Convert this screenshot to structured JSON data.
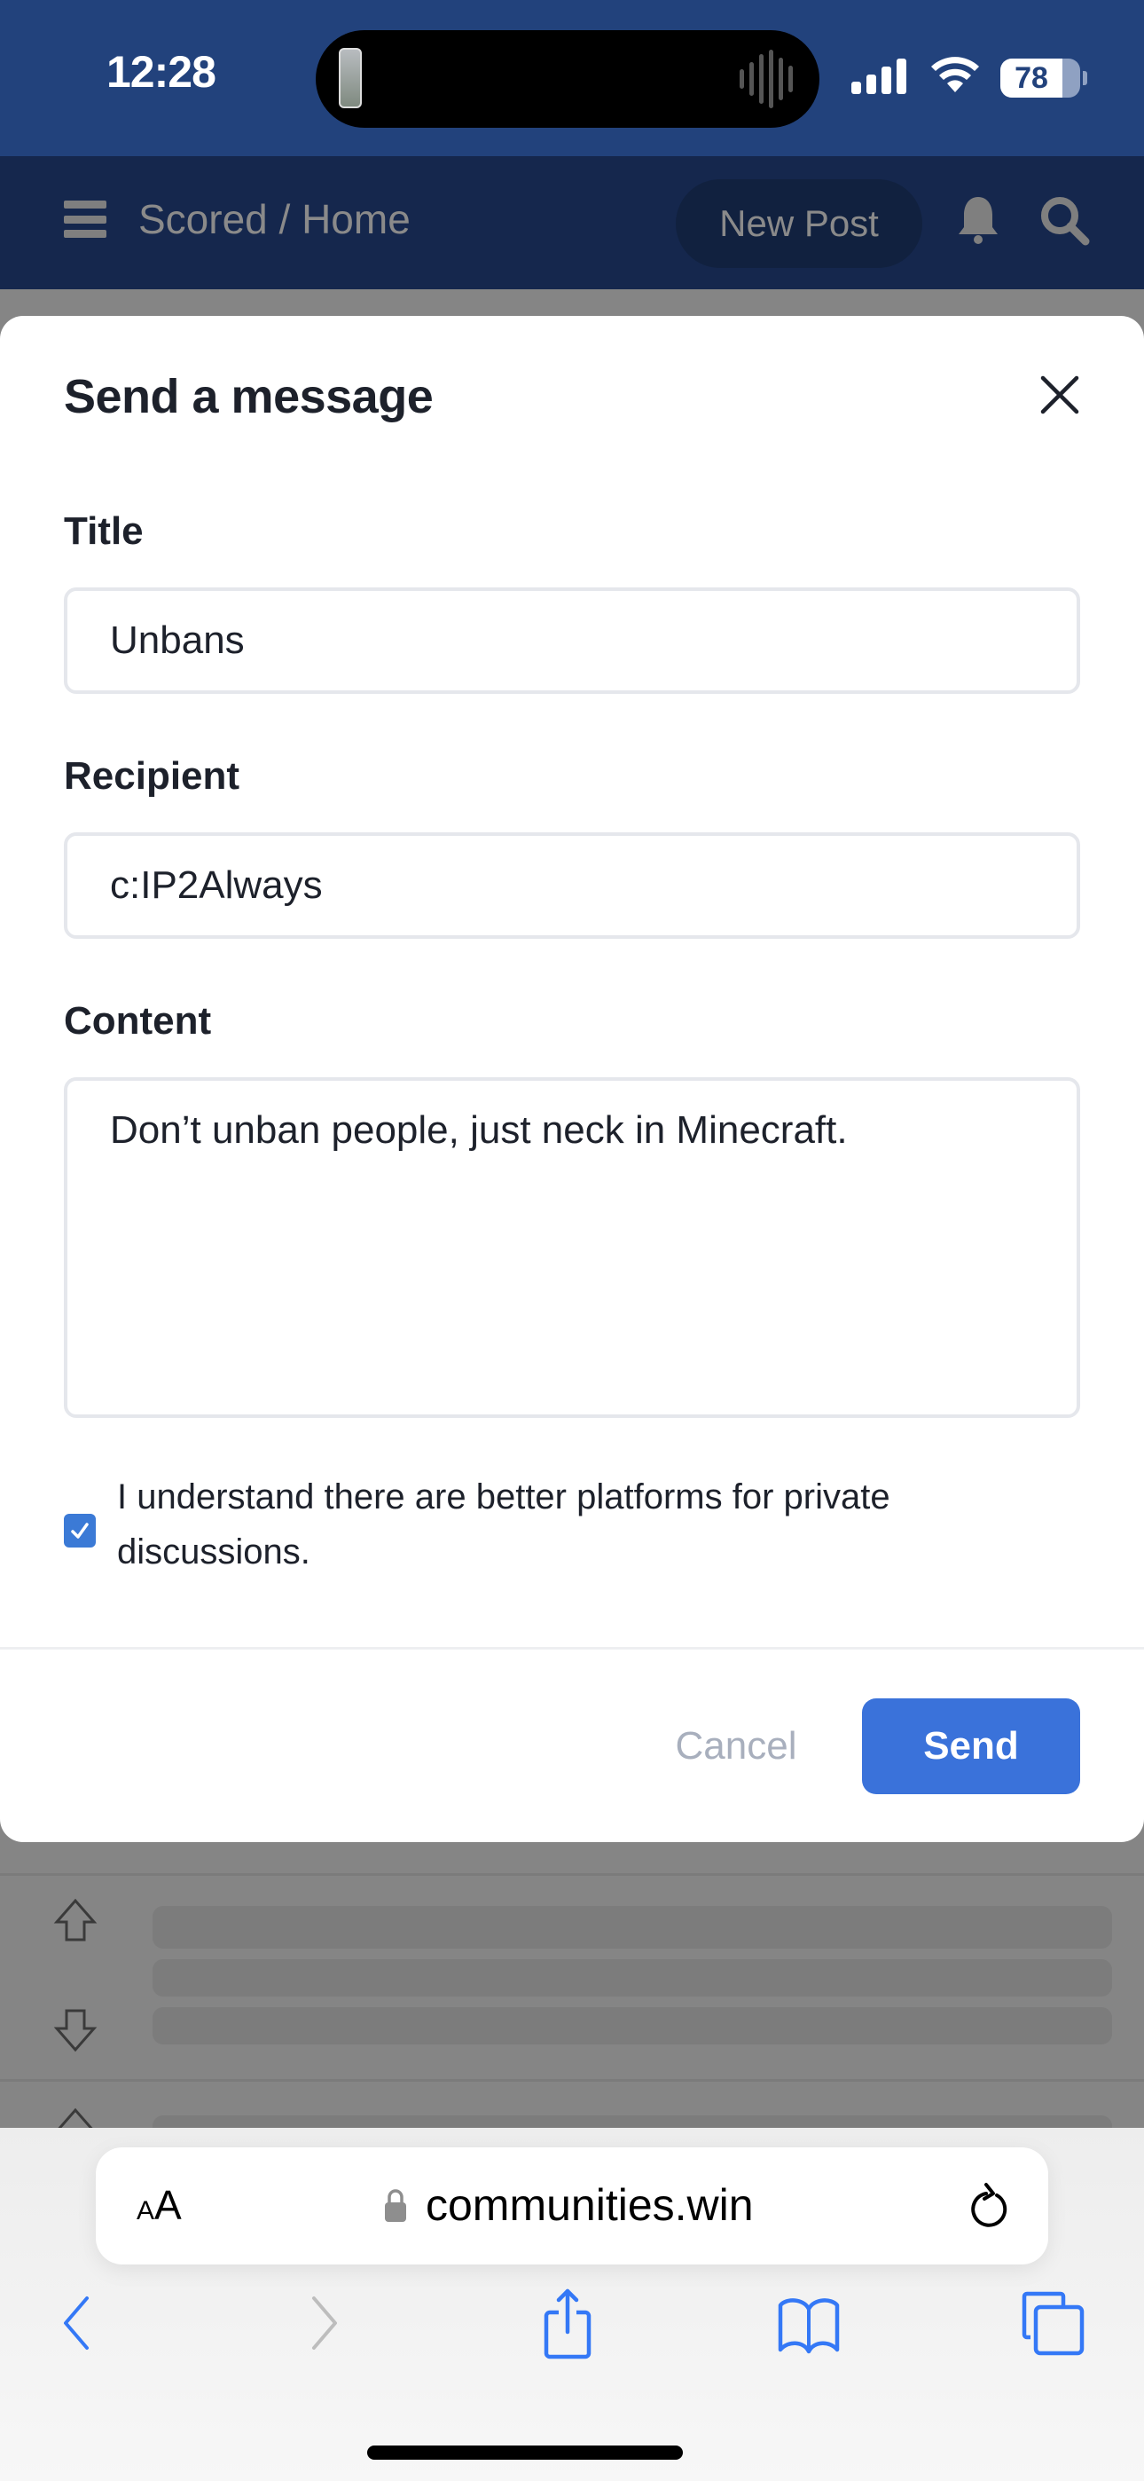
{
  "status_bar": {
    "time": "12:28",
    "battery_level": 78,
    "battery_label": "78"
  },
  "site_header": {
    "title": "Scored / Home",
    "new_post_label": "New Post",
    "icons": [
      "menu-icon",
      "bell-icon",
      "search-icon"
    ]
  },
  "modal": {
    "title": "Send a message",
    "title_field": {
      "label": "Title",
      "value": "Unbans"
    },
    "recipient_field": {
      "label": "Recipient",
      "value": "c:IP2Always"
    },
    "content_field": {
      "label": "Content",
      "value": "Don’t unban people, just neck in Minecraft."
    },
    "acknowledge": {
      "checked": true,
      "label": "I understand there are better platforms for private discussions."
    },
    "cancel_label": "Cancel",
    "send_label": "Send",
    "accent_color": "#3a72da"
  },
  "browser": {
    "text_size_label_small": "A",
    "text_size_label_large": "A",
    "url": "communities.win",
    "toolbar": [
      "back-icon",
      "forward-icon",
      "share-icon",
      "bookmarks-icon",
      "tabs-icon"
    ],
    "tint_color": "#3478f6"
  }
}
